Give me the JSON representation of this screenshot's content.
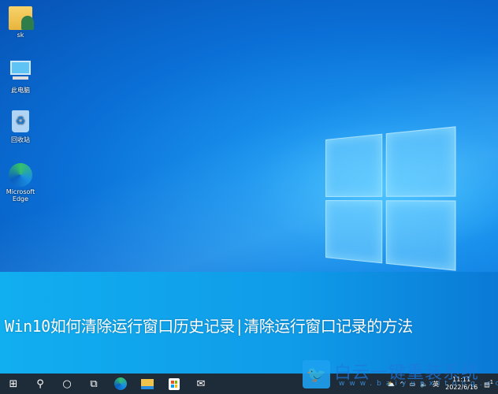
{
  "desktop": {
    "icons": [
      {
        "label": "sk",
        "icon": "user-folder-icon"
      },
      {
        "label": "此电脑",
        "icon": "computer-icon"
      },
      {
        "label": "回收站",
        "icon": "recycle-bin-icon"
      },
      {
        "label": "Microsoft Edge",
        "icon": "edge-icon"
      }
    ]
  },
  "title": "Win10如何清除运行窗口历史记录|清除运行窗口记录的方法",
  "watermark": {
    "name": "白云一键重装系统",
    "url": "www.baiyunxitong.com"
  },
  "taskbar": {
    "items": [
      "start-icon",
      "search-icon",
      "cortana-icon",
      "task-view-icon",
      "edge-icon",
      "file-explorer-icon",
      "store-icon",
      "mail-icon"
    ]
  },
  "tray": {
    "ime": "英",
    "time": "11:11",
    "date": "2022/6/16",
    "notifications": "1"
  }
}
